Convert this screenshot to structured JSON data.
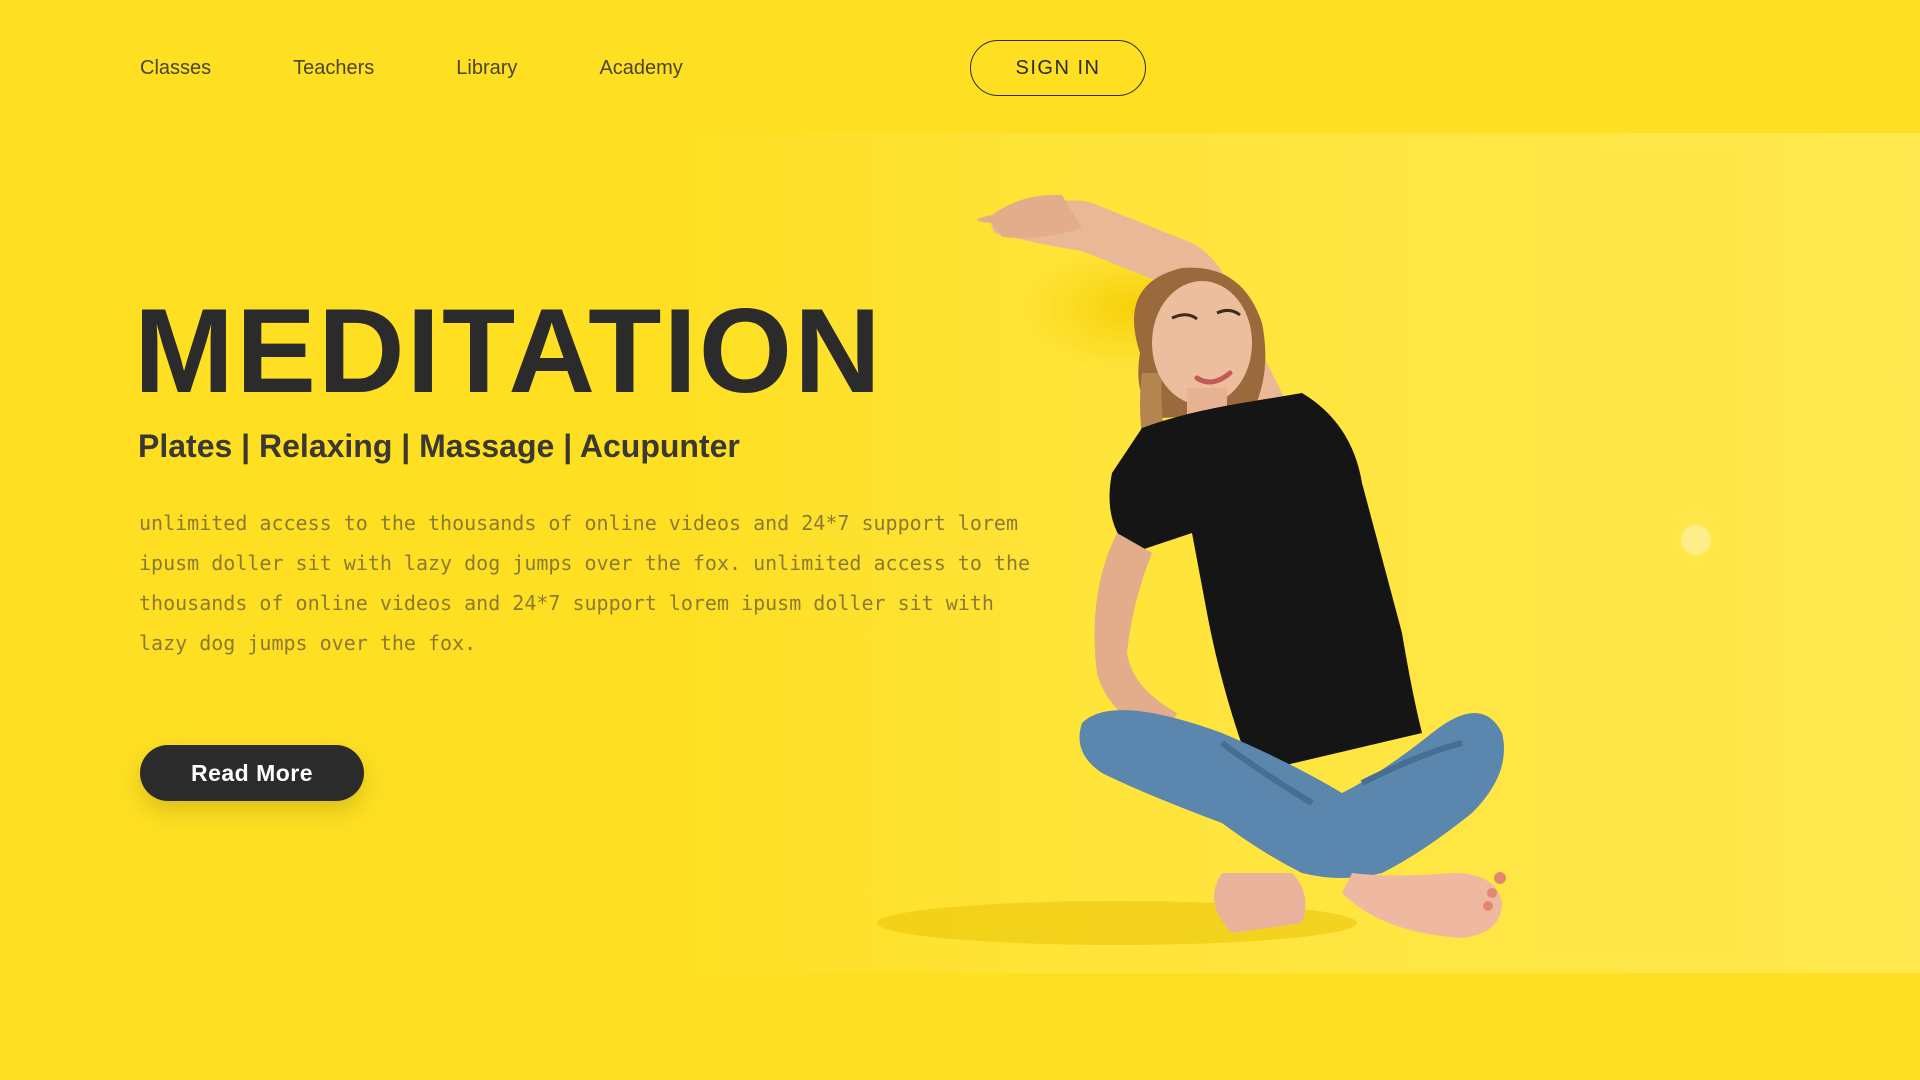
{
  "nav": {
    "items": [
      {
        "label": "Classes"
      },
      {
        "label": "Teachers"
      },
      {
        "label": "Library"
      },
      {
        "label": "Academy"
      }
    ],
    "signin_label": "SIGN IN"
  },
  "hero": {
    "title": "MEDITATION",
    "subtitle": "Plates | Relaxing | Massage | Acupunter",
    "body": "unlimited access to the thousands of online videos and 24*7 support lorem ipusm doller sit with lazy dog jumps over the fox. unlimited access to the thousands of online videos and 24*7 support lorem ipusm doller sit with lazy dog jumps over the fox.",
    "cta_label": "Read More"
  },
  "colors": {
    "background": "#FEDF22",
    "text_dark": "#2b2b2b",
    "body_text": "#8a7a35"
  }
}
